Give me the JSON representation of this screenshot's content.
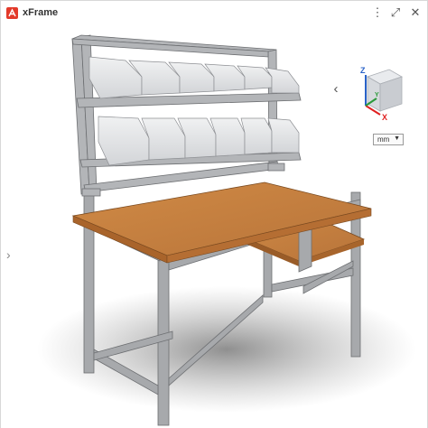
{
  "window": {
    "title": "xFrame",
    "controls": {
      "more": "⋮",
      "expand": "⤢",
      "close": "✕"
    }
  },
  "viewer": {
    "collapse_arrow": "‹",
    "left_handle": "›",
    "view_cube": {
      "axis_x": "X",
      "axis_y": "Y",
      "axis_z": "Z"
    },
    "units": {
      "selected": "mm",
      "arrow": "▼"
    }
  },
  "colors": {
    "accent": "#e33a2a",
    "tabletop": "#c8823f",
    "frame": "#a7a9ac",
    "bins": "#e3e4e6",
    "axis_x": "#e02020",
    "axis_y": "#2b9a3a",
    "axis_z": "#2a63c9"
  },
  "icons": [
    "app-logo-icon",
    "more-icon",
    "expand-icon",
    "close-icon",
    "chevron-left-icon",
    "chevron-right-icon",
    "view-cube-icon",
    "dropdown-arrow-icon"
  ]
}
